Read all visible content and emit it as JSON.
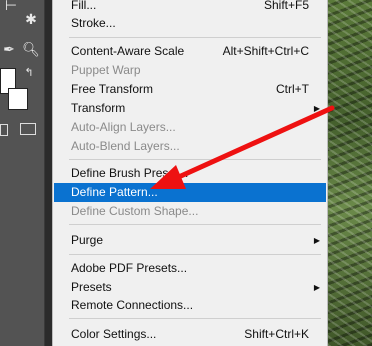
{
  "menu": {
    "items": [
      {
        "label": "Fill...",
        "shortcut": "Shift+F5"
      },
      {
        "label": "Stroke..."
      },
      {
        "label": "Content-Aware Scale",
        "shortcut": "Alt+Shift+Ctrl+C"
      },
      {
        "label": "Puppet Warp"
      },
      {
        "label": "Free Transform",
        "shortcut": "Ctrl+T"
      },
      {
        "label": "Transform"
      },
      {
        "label": "Auto-Align Layers..."
      },
      {
        "label": "Auto-Blend Layers..."
      },
      {
        "label": "Define Brush Preset..."
      },
      {
        "label": "Define Pattern..."
      },
      {
        "label": "Define Custom Shape..."
      },
      {
        "label": "Purge"
      },
      {
        "label": "Adobe PDF Presets..."
      },
      {
        "label": "Presets"
      },
      {
        "label": "Remote Connections..."
      },
      {
        "label": "Color Settings...",
        "shortcut": "Shift+Ctrl+K"
      }
    ],
    "submenu_arrow": "▶"
  },
  "annotation": {
    "color": "#ee1111"
  },
  "colors": {
    "highlight": "#0a72d0",
    "menu_bg": "#f0f0f0",
    "disabled_text": "#8a8a8a"
  }
}
